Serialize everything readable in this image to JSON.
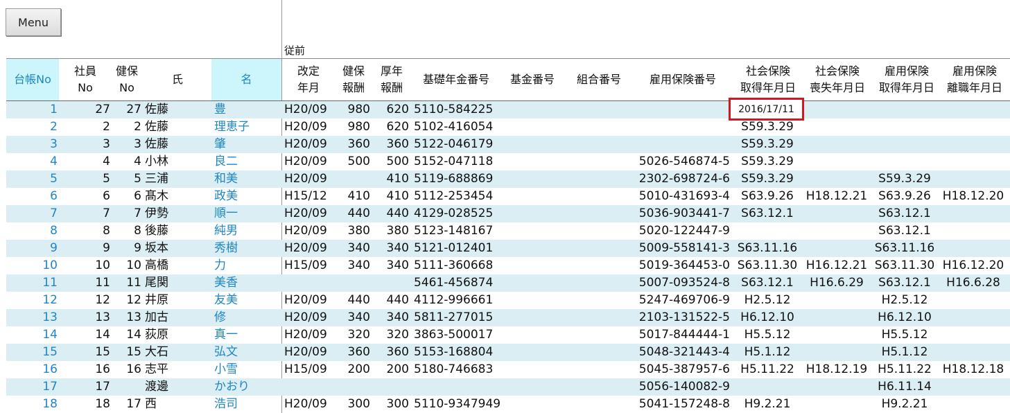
{
  "menu_label": "Menu",
  "section_label": "従前",
  "headers": {
    "daicho": "台帳No",
    "shain": "社員\nNo",
    "kenpo": "健保\nNo",
    "sei": "氏",
    "mei": "名",
    "kaitei": "改定\n年月",
    "kenpo_hoshu": "健保\n報酬",
    "kounen_hoshu": "厚年\n報酬",
    "kiso": "基礎年金番号",
    "kikin": "基金番号",
    "kumiai": "組合番号",
    "koyo_no": "雇用保険番号",
    "shakai_get": "社会保険\n取得年月日",
    "shakai_loss": "社会保険\n喪失年月日",
    "koyo_get": "雇用保険\n取得年月日",
    "koyo_leave": "雇用保険\n離職年月日"
  },
  "highlighted_value": "2016/17/11",
  "rows": [
    {
      "daicho": "1",
      "shain": "27",
      "kenpo": "27",
      "sei": "佐藤",
      "mei": "豊",
      "kaitei": "H20/09",
      "kenpo_hoshu": "980",
      "kounen_hoshu": "620",
      "kiso": "5110-584225",
      "koyo_no": "",
      "shakai_get": "",
      "shakai_loss": "",
      "koyo_get": "",
      "koyo_leave": ""
    },
    {
      "daicho": "2",
      "shain": "2",
      "kenpo": "2",
      "sei": "佐藤",
      "mei": "理恵子",
      "kaitei": "H20/09",
      "kenpo_hoshu": "980",
      "kounen_hoshu": "620",
      "kiso": "5102-416054",
      "koyo_no": "",
      "shakai_get": "S59.3.29",
      "shakai_loss": "",
      "koyo_get": "",
      "koyo_leave": ""
    },
    {
      "daicho": "3",
      "shain": "3",
      "kenpo": "3",
      "sei": "佐藤",
      "mei": "肇",
      "kaitei": "H20/09",
      "kenpo_hoshu": "360",
      "kounen_hoshu": "360",
      "kiso": "5122-046179",
      "koyo_no": "",
      "shakai_get": "S59.3.29",
      "shakai_loss": "",
      "koyo_get": "",
      "koyo_leave": ""
    },
    {
      "daicho": "4",
      "shain": "4",
      "kenpo": "4",
      "sei": "小林",
      "mei": "良二",
      "kaitei": "H20/09",
      "kenpo_hoshu": "500",
      "kounen_hoshu": "500",
      "kiso": "5152-047118",
      "koyo_no": "5026-546874-5",
      "shakai_get": "S59.3.29",
      "shakai_loss": "",
      "koyo_get": "",
      "koyo_leave": ""
    },
    {
      "daicho": "5",
      "shain": "5",
      "kenpo": "5",
      "sei": "三浦",
      "mei": "和美",
      "kaitei": "H20/09",
      "kenpo_hoshu": "",
      "kounen_hoshu": "410",
      "kiso": "5119-688869",
      "koyo_no": "2302-698724-6",
      "shakai_get": "S59.3.29",
      "shakai_loss": "",
      "koyo_get": "S59.3.29",
      "koyo_leave": ""
    },
    {
      "daicho": "6",
      "shain": "6",
      "kenpo": "6",
      "sei": "髙木",
      "mei": "政美",
      "kaitei": "H15/12",
      "kenpo_hoshu": "410",
      "kounen_hoshu": "410",
      "kiso": "5112-253454",
      "koyo_no": "5010-431693-4",
      "shakai_get": "S63.9.26",
      "shakai_loss": "H18.12.21",
      "koyo_get": "S63.9.26",
      "koyo_leave": "H18.12.20"
    },
    {
      "daicho": "7",
      "shain": "7",
      "kenpo": "7",
      "sei": "伊勢",
      "mei": "順一",
      "kaitei": "H20/09",
      "kenpo_hoshu": "440",
      "kounen_hoshu": "440",
      "kiso": "4129-028525",
      "koyo_no": "5036-903441-7",
      "shakai_get": "S63.12.1",
      "shakai_loss": "",
      "koyo_get": "S63.12.1",
      "koyo_leave": ""
    },
    {
      "daicho": "8",
      "shain": "8",
      "kenpo": "8",
      "sei": "後藤",
      "mei": "純男",
      "kaitei": "H20/09",
      "kenpo_hoshu": "380",
      "kounen_hoshu": "380",
      "kiso": "5123-148167",
      "koyo_no": "5020-122447-9",
      "shakai_get": "",
      "shakai_loss": "",
      "koyo_get": "S63.12.1",
      "koyo_leave": ""
    },
    {
      "daicho": "9",
      "shain": "9",
      "kenpo": "9",
      "sei": "坂本",
      "mei": "秀樹",
      "kaitei": "H20/09",
      "kenpo_hoshu": "340",
      "kounen_hoshu": "340",
      "kiso": "5121-012401",
      "koyo_no": "5009-558141-3",
      "shakai_get": "S63.11.16",
      "shakai_loss": "",
      "koyo_get": "S63.11.16",
      "koyo_leave": ""
    },
    {
      "daicho": "10",
      "shain": "10",
      "kenpo": "10",
      "sei": "高橋",
      "mei": "力",
      "kaitei": "H15/09",
      "kenpo_hoshu": "340",
      "kounen_hoshu": "340",
      "kiso": "5111-360668",
      "koyo_no": "5019-364453-0",
      "shakai_get": "S63.11.30",
      "shakai_loss": "H16.12.21",
      "koyo_get": "S63.11.30",
      "koyo_leave": "H16.12.20"
    },
    {
      "daicho": "11",
      "shain": "11",
      "kenpo": "11",
      "sei": "尾関",
      "mei": "美香",
      "kaitei": "",
      "kenpo_hoshu": "",
      "kounen_hoshu": "",
      "kiso": "5461-456874",
      "koyo_no": "5007-093524-8",
      "shakai_get": "S63.12.1",
      "shakai_loss": "H16.6.29",
      "koyo_get": "S63.12.1",
      "koyo_leave": "H16.6.28"
    },
    {
      "daicho": "12",
      "shain": "12",
      "kenpo": "12",
      "sei": "井原",
      "mei": "友美",
      "kaitei": "H20/09",
      "kenpo_hoshu": "440",
      "kounen_hoshu": "440",
      "kiso": "4112-996661",
      "koyo_no": "5247-469706-9",
      "shakai_get": "H2.5.12",
      "shakai_loss": "",
      "koyo_get": "H2.5.12",
      "koyo_leave": ""
    },
    {
      "daicho": "13",
      "shain": "13",
      "kenpo": "13",
      "sei": "加古",
      "mei": "修",
      "kaitei": "H20/09",
      "kenpo_hoshu": "340",
      "kounen_hoshu": "340",
      "kiso": "5811-277015",
      "koyo_no": "2103-131522-5",
      "shakai_get": "H6.12.10",
      "shakai_loss": "",
      "koyo_get": "H6.12.10",
      "koyo_leave": ""
    },
    {
      "daicho": "14",
      "shain": "14",
      "kenpo": "14",
      "sei": "荻原",
      "mei": "真一",
      "kaitei": "H20/09",
      "kenpo_hoshu": "320",
      "kounen_hoshu": "320",
      "kiso": "3863-500017",
      "koyo_no": "5017-844444-1",
      "shakai_get": "H5.5.12",
      "shakai_loss": "",
      "koyo_get": "H5.5.12",
      "koyo_leave": ""
    },
    {
      "daicho": "15",
      "shain": "15",
      "kenpo": "15",
      "sei": "大石",
      "mei": "弘文",
      "kaitei": "H20/09",
      "kenpo_hoshu": "360",
      "kounen_hoshu": "360",
      "kiso": "5153-168804",
      "koyo_no": "5048-321443-4",
      "shakai_get": "H5.1.12",
      "shakai_loss": "",
      "koyo_get": "H5.1.12",
      "koyo_leave": ""
    },
    {
      "daicho": "16",
      "shain": "16",
      "kenpo": "16",
      "sei": "志平",
      "mei": "小雪",
      "kaitei": "H15/09",
      "kenpo_hoshu": "200",
      "kounen_hoshu": "200",
      "kiso": "5180-746683",
      "koyo_no": "5045-387957-6",
      "shakai_get": "H5.11.22",
      "shakai_loss": "H18.12.19",
      "koyo_get": "H5.11.22",
      "koyo_leave": "H18.12.18"
    },
    {
      "daicho": "17",
      "shain": "17",
      "kenpo": "",
      "sei": "渡邊",
      "mei": "かおり",
      "kaitei": "",
      "kenpo_hoshu": "",
      "kounen_hoshu": "",
      "kiso": "",
      "koyo_no": "5056-140082-9",
      "shakai_get": "",
      "shakai_loss": "",
      "koyo_get": "H6.11.14",
      "koyo_leave": ""
    },
    {
      "daicho": "18",
      "shain": "18",
      "kenpo": "17",
      "sei": "西",
      "mei": "浩司",
      "kaitei": "H20/09",
      "kenpo_hoshu": "300",
      "kounen_hoshu": "300",
      "kiso": "5110-9347949",
      "koyo_no": "5041-157248-8",
      "shakai_get": "H9.2.21",
      "shakai_loss": "",
      "koyo_get": "H9.2.21",
      "koyo_leave": ""
    }
  ]
}
